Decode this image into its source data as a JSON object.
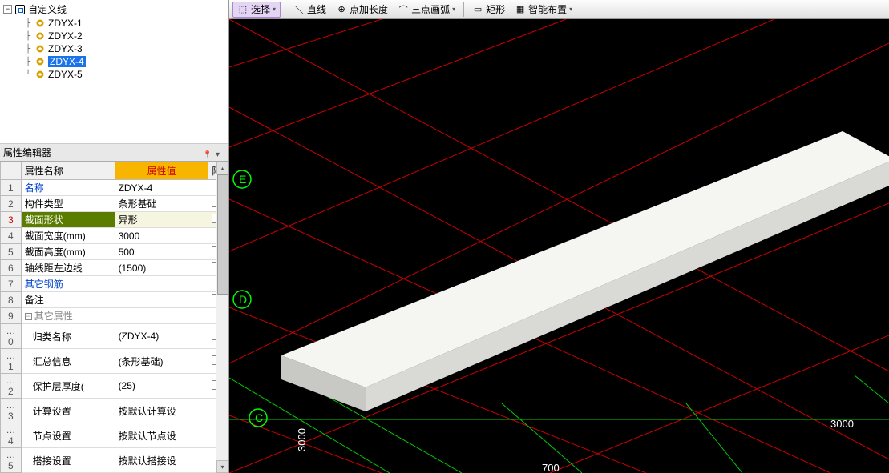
{
  "tree": {
    "root": {
      "label": "自定义线"
    },
    "items": [
      {
        "label": "ZDYX-1",
        "selected": false
      },
      {
        "label": "ZDYX-2",
        "selected": false
      },
      {
        "label": "ZDYX-3",
        "selected": false
      },
      {
        "label": "ZDYX-4",
        "selected": true
      },
      {
        "label": "ZDYX-5",
        "selected": false
      }
    ]
  },
  "prop_panel_title": "属性编辑器",
  "prop_headers": {
    "name": "属性名称",
    "value": "属性值",
    "attach": "附"
  },
  "properties": [
    {
      "num": "1",
      "name": "名称",
      "value": "ZDYX-4",
      "link": true,
      "check": false
    },
    {
      "num": "2",
      "name": "构件类型",
      "value": "条形基础",
      "check": true
    },
    {
      "num": "3",
      "name": "截面形状",
      "value": "异形",
      "highlight": true,
      "check": true
    },
    {
      "num": "4",
      "name": "截面宽度(mm)",
      "value": "3000",
      "check": true
    },
    {
      "num": "5",
      "name": "截面高度(mm)",
      "value": "500",
      "check": true
    },
    {
      "num": "6",
      "name": "轴线距左边线",
      "value": "(1500)",
      "check": true
    },
    {
      "num": "7",
      "name": "其它钢筋",
      "value": "",
      "link": true,
      "check": false
    },
    {
      "num": "8",
      "name": "备注",
      "value": "",
      "check": true
    },
    {
      "num": "9",
      "name": "其它属性",
      "value": "",
      "group": true
    },
    {
      "num": "…0",
      "name": "归类名称",
      "value": "(ZDYX-4)",
      "indent": true,
      "check": true
    },
    {
      "num": "…1",
      "name": "汇总信息",
      "value": "(条形基础)",
      "indent": true,
      "check": true
    },
    {
      "num": "…2",
      "name": "保护层厚度(",
      "value": "(25)",
      "indent": true,
      "check": true
    },
    {
      "num": "…3",
      "name": "计算设置",
      "value": "按默认计算设",
      "indent": true,
      "check": false
    },
    {
      "num": "…4",
      "name": "节点设置",
      "value": "按默认节点设",
      "indent": true,
      "check": false
    },
    {
      "num": "…5",
      "name": "搭接设置",
      "value": "按默认搭接设",
      "indent": true,
      "check": false
    }
  ],
  "toolbar": {
    "select": "选择",
    "line": "直线",
    "add_length": "点加长度",
    "three_point_arc": "三点画弧",
    "rect": "矩形",
    "smart_layout": "智能布置"
  },
  "viewport": {
    "labels": {
      "e": "E",
      "d": "D",
      "c": "C"
    },
    "dims": {
      "d3000_left": "3000",
      "d3000_right": "3000",
      "d700": "700"
    }
  }
}
